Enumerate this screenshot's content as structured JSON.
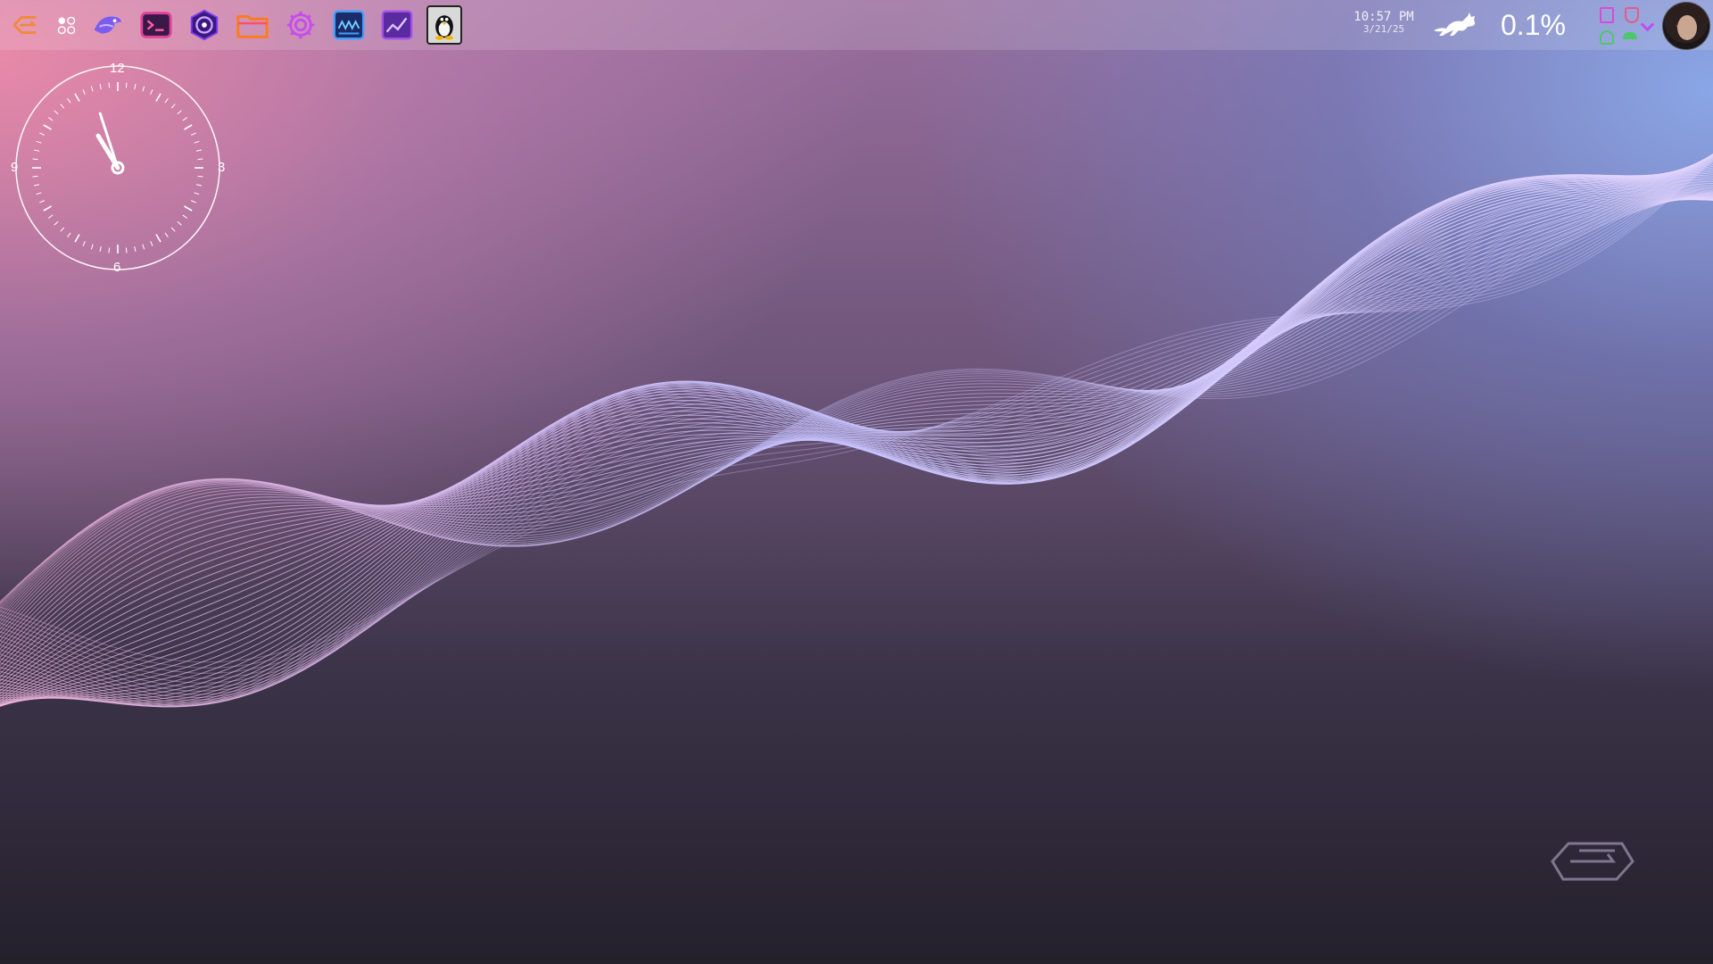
{
  "desktop": {
    "dock": {
      "apps": [
        {
          "name": "garuda-launcher-icon",
          "color": "#f08a3c"
        },
        {
          "name": "app-grid-icon",
          "color": "#ffffff"
        },
        {
          "name": "browser-bird-icon",
          "color": "#7b5cf0"
        },
        {
          "name": "terminal-icon",
          "color": "#e0409a"
        },
        {
          "name": "assistant-hex-icon",
          "color": "#6b2fd0"
        },
        {
          "name": "file-manager-icon",
          "color": "#ff7a1a"
        },
        {
          "name": "settings-gear-icon",
          "color": "#c64cf0"
        },
        {
          "name": "system-monitor-icon",
          "color": "#3aa0ff"
        },
        {
          "name": "activity-chart-icon",
          "color": "#a64ce8"
        },
        {
          "name": "tux-penguin-icon",
          "color": "#111111"
        }
      ]
    },
    "status": {
      "time": "10:57 PM",
      "date": "3/21/25",
      "cpu_usage": "0.1%"
    },
    "clock_widget": {
      "numerals": {
        "top": "12",
        "right": "3",
        "bottom": "6",
        "left": "9"
      },
      "hour": 10,
      "minute": 57
    },
    "colors": {
      "wave_pink": "#f2b3dc",
      "wave_lavender": "#c5c2ff",
      "accent_purple": "#c14cf0"
    }
  }
}
